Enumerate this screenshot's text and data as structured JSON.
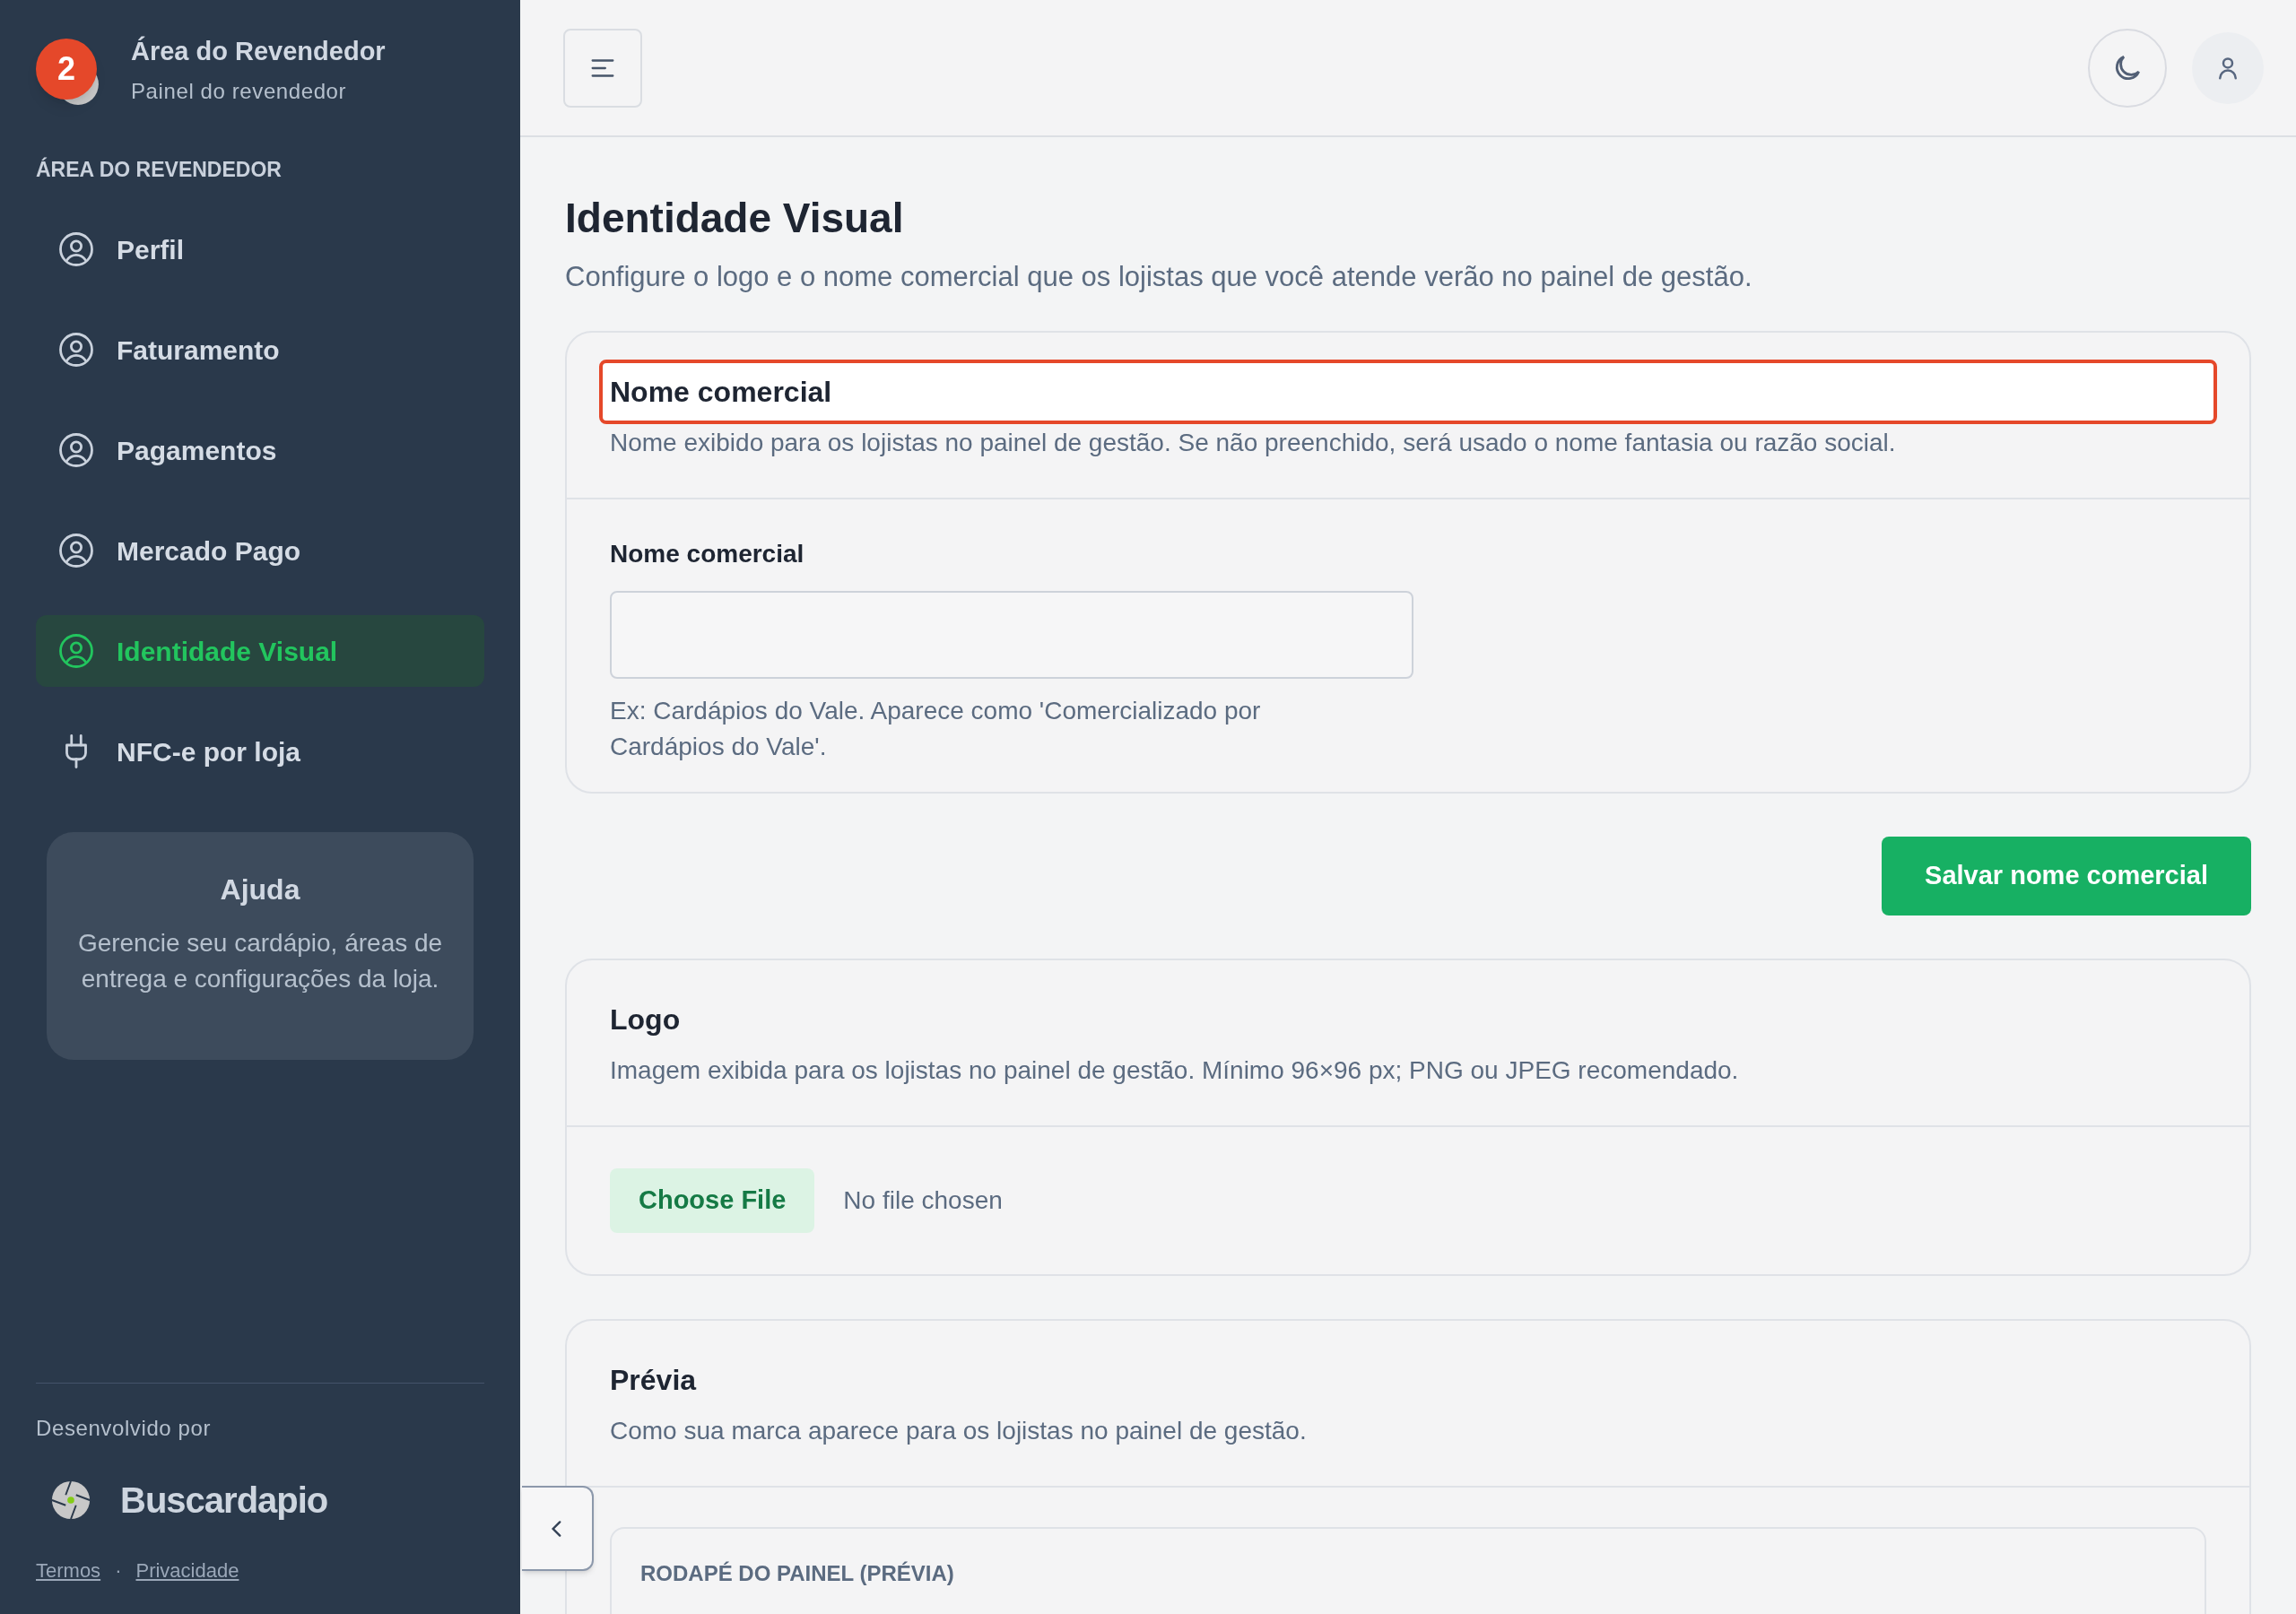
{
  "sidebar": {
    "badge": "2",
    "title": "Área do Revendedor",
    "subtitle": "Painel do revendedor",
    "section": "ÁREA DO REVENDEDOR",
    "items": [
      {
        "label": "Perfil",
        "kind": "user",
        "selected": false
      },
      {
        "label": "Faturamento",
        "kind": "user",
        "selected": false
      },
      {
        "label": "Pagamentos",
        "kind": "user",
        "selected": false
      },
      {
        "label": "Mercado Pago",
        "kind": "user",
        "selected": false
      },
      {
        "label": "Identidade Visual",
        "kind": "user",
        "selected": true
      },
      {
        "label": "NFC-e por loja",
        "kind": "plug",
        "selected": false
      }
    ],
    "help": {
      "title": "Ajuda",
      "text": "Gerencie seu cardápio, áreas de entrega e configurações da loja."
    },
    "footer": {
      "developed_by": "Desenvolvido por",
      "brand": "Buscardapio",
      "links": [
        "Termos",
        "Privacidade"
      ],
      "separator": "·"
    }
  },
  "page": {
    "title": "Identidade Visual",
    "subtitle": "Configure o logo e o nome comercial que os lojistas que você atende verão no painel de gestão."
  },
  "name_card": {
    "title": "Nome comercial",
    "highlighted": true,
    "description": "Nome exibido para os lojistas no painel de gestão. Se não preenchido, será usado o nome fantasia ou razão social.",
    "field_label": "Nome comercial",
    "hint": "Ex: Cardápios do Vale. Aparece como 'Comercializado por Cardápios do Vale'."
  },
  "save_button": "Salvar nome comercial",
  "logo_card": {
    "title": "Logo",
    "description": "Imagem exibida para os lojistas no painel de gestão. Mínimo 96×96 px; PNG ou JPEG recomendado.",
    "file_button": "Choose File",
    "file_status": "No file chosen"
  },
  "preview_card": {
    "title": "Prévia",
    "description": "Como sua marca aparece para os lojistas no painel de gestão.",
    "footer_label": "RODAPÉ DO PAINEL (PRÉVIA)"
  }
}
